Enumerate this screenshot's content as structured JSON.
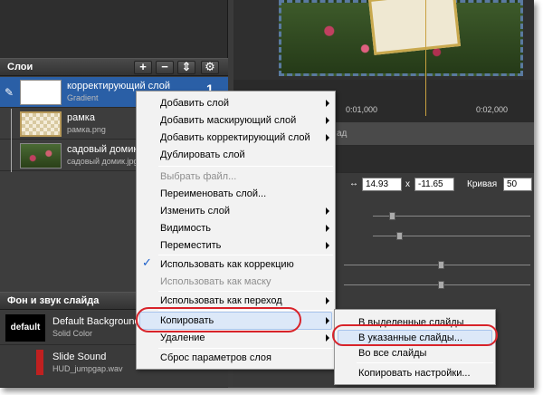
{
  "layers_panel": {
    "title": "Слои",
    "buttons": [
      "+",
      "−",
      "⇕",
      "⚙"
    ],
    "items": [
      {
        "name": "корректирующий слой",
        "sub": "Gradient",
        "selected": true
      },
      {
        "name": "рамка",
        "sub": "рамка.png",
        "selected": false
      },
      {
        "name": "садовый домик",
        "sub": "садовый домик.jpg",
        "selected": false
      }
    ],
    "selected_index_label": "1"
  },
  "background_panel": {
    "title": "Фон и звук слайда",
    "items": [
      {
        "thumb": "default",
        "name": "Default Background",
        "sub": "Solid Color"
      },
      {
        "name": "Slide Sound",
        "sub": "HUD_jumpgap.wav"
      }
    ]
  },
  "timeline": {
    "time_labels": [
      "0:01,000",
      "0:02,000"
    ],
    "partial_label": "ад"
  },
  "properties": {
    "x_value": "14.93",
    "x_sep": "x",
    "y_value": "-11.65",
    "curve_label": "Кривая",
    "curve_value": "50"
  },
  "context_menu": {
    "items": [
      {
        "label": "Добавить слой",
        "submenu": true,
        "disabled": false
      },
      {
        "label": "Добавить маскирующий слой",
        "submenu": true,
        "disabled": false
      },
      {
        "label": "Добавить корректирующий слой",
        "submenu": true,
        "disabled": false
      },
      {
        "label": "Дублировать слой",
        "submenu": false,
        "disabled": false
      },
      {
        "label": "Выбрать файл...",
        "submenu": false,
        "disabled": true
      },
      {
        "label": "Переименовать слой...",
        "submenu": false,
        "disabled": false
      },
      {
        "label": "Изменить слой",
        "submenu": true,
        "disabled": false
      },
      {
        "label": "Видимость",
        "submenu": true,
        "disabled": false
      },
      {
        "label": "Переместить",
        "submenu": true,
        "disabled": false
      },
      {
        "label": "Использовать как коррекцию",
        "submenu": false,
        "disabled": false,
        "checked": true
      },
      {
        "label": "Использовать как маску",
        "submenu": false,
        "disabled": true
      },
      {
        "label": "Использовать как переход",
        "submenu": true,
        "disabled": false
      },
      {
        "label": "Копировать",
        "submenu": true,
        "disabled": false,
        "highlighted": true
      },
      {
        "label": "Удаление",
        "submenu": true,
        "disabled": false
      },
      {
        "label": "Сброс параметров слоя",
        "submenu": false,
        "disabled": false
      }
    ]
  },
  "copy_submenu": {
    "items": [
      {
        "label": "В выделенные слайды",
        "highlighted": false
      },
      {
        "label": "В указанные слайды...",
        "highlighted": true
      },
      {
        "label": "Во все слайды",
        "highlighted": false
      },
      {
        "label": "Копировать настройки...",
        "highlighted": false
      }
    ]
  },
  "colors": {
    "selection": "#2a5fa6",
    "annotation_red": "#d8232a",
    "menu_bg": "#f2f2f2"
  }
}
